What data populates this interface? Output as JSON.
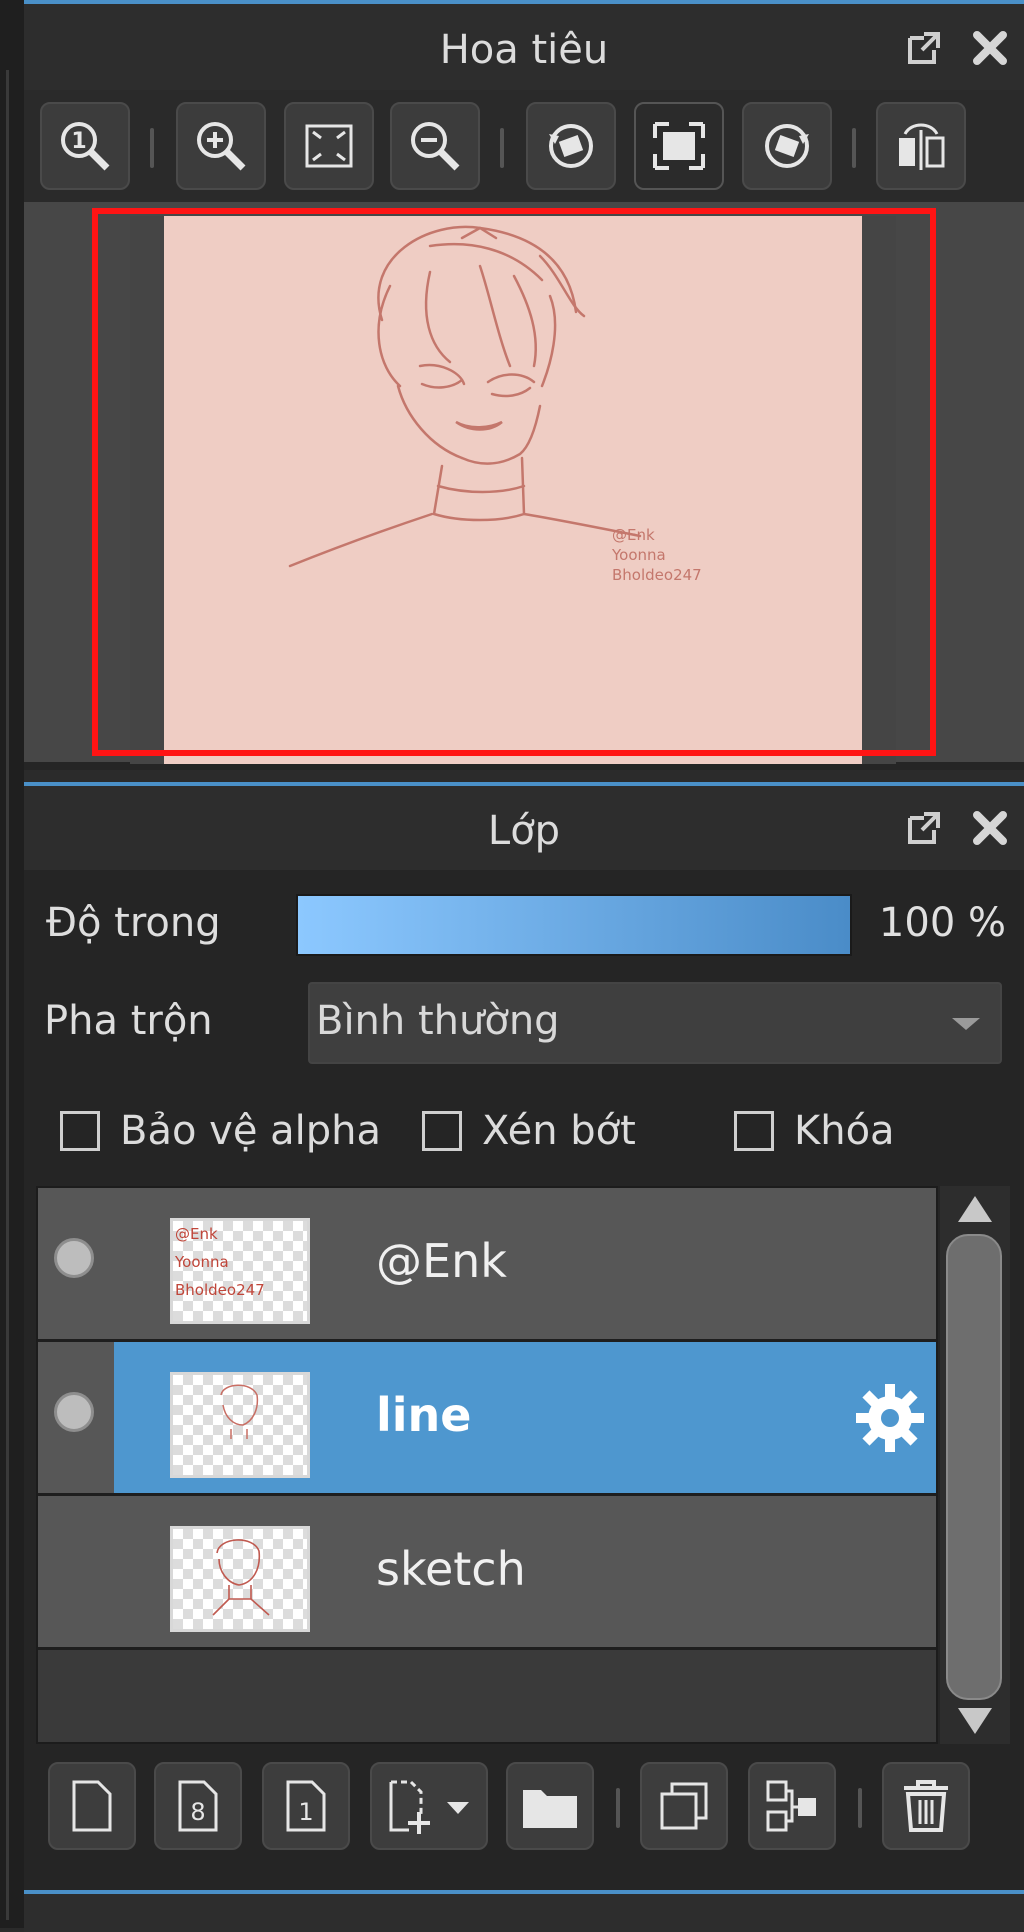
{
  "navigator": {
    "title": "Hoa tiêu",
    "tools": [
      "zoom-actual-icon",
      "zoom-in-icon",
      "fit-screen-icon",
      "zoom-out-icon",
      "rotate-left-icon",
      "fit-window-icon",
      "rotate-right-icon",
      "flip-horizontal-icon"
    ],
    "canvas_text": [
      "@Enk",
      "Yoonna",
      "Bholdeo247"
    ]
  },
  "layers": {
    "title": "Lớp",
    "opacity_label": "Độ trong",
    "opacity_value": "100 %",
    "opacity_fraction": 1.0,
    "blend_label": "Pha trộn",
    "blend_value": "Bình thường",
    "protect_alpha": "Bảo vệ alpha",
    "clipping": "Xén bớt",
    "lock": "Khóa",
    "items": [
      {
        "name": "@Enk",
        "visible": true,
        "selected": false
      },
      {
        "name": "line",
        "visible": true,
        "selected": true
      },
      {
        "name": "sketch",
        "visible": false,
        "selected": false
      }
    ],
    "bottom_tools": [
      "new-layer-icon",
      "new-8bit-layer-icon",
      "new-1bit-layer-icon",
      "add-layer-menu-icon",
      "new-folder-icon",
      "duplicate-layer-icon",
      "merge-down-icon",
      "delete-layer-icon"
    ]
  },
  "colors": {
    "accent": "#4a90c8",
    "selected": "#4e97cf",
    "frame": "#ff1414",
    "canvas": "#efcdc4"
  }
}
